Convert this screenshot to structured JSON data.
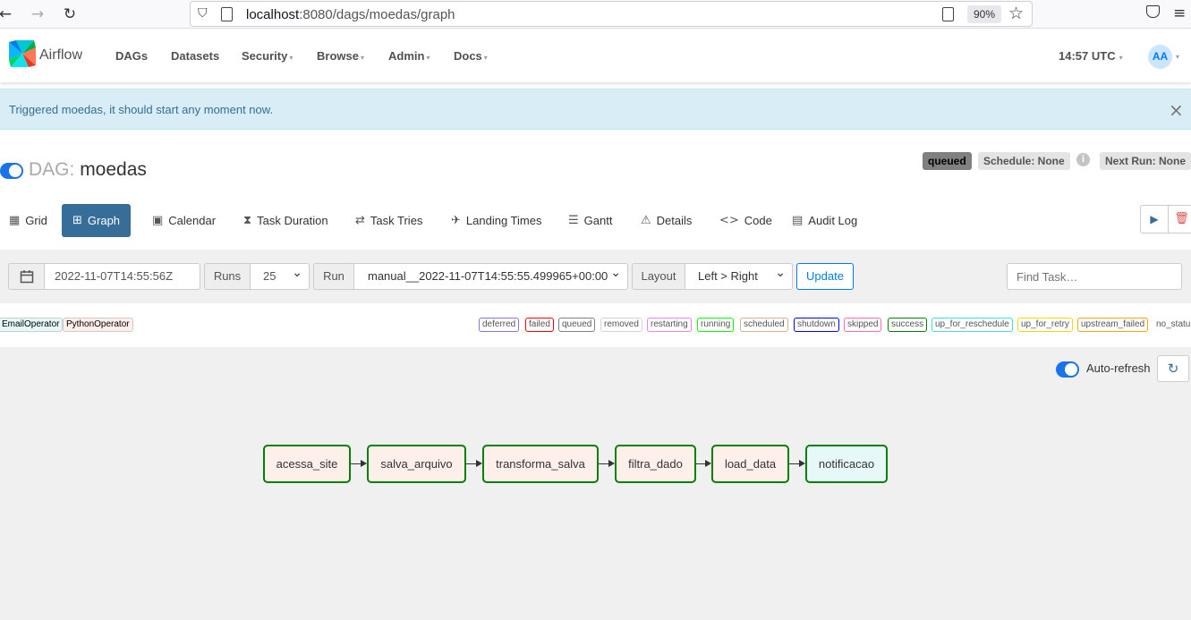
{
  "browser": {
    "url_host": "localhost",
    "url_rest": ":8080/dags/moedas/graph",
    "zoom": "90%"
  },
  "navbar": {
    "brand": "Airflow",
    "items": [
      "DAGs",
      "Datasets",
      "Security",
      "Browse",
      "Admin",
      "Docs"
    ],
    "clock": "14:57 UTC",
    "avatar": "AA"
  },
  "alert": {
    "message": "Triggered moedas, it should start any moment now.",
    "close": "×"
  },
  "dag": {
    "prefix": "DAG:",
    "name": "moedas",
    "state": "queued",
    "schedule": "Schedule: None",
    "next_run": "Next Run: None"
  },
  "tabs": [
    "Grid",
    "Graph",
    "Calendar",
    "Task Duration",
    "Task Tries",
    "Landing Times",
    "Gantt",
    "Details",
    "Code",
    "Audit Log"
  ],
  "filters": {
    "date": "2022-11-07T14:55:56Z",
    "runs_label": "Runs",
    "runs_value": "25",
    "run_label": "Run",
    "run_value": "manual__2022-11-07T14:55:55.499965+00:00",
    "layout_label": "Layout",
    "layout_value": "Left > Right",
    "update": "Update",
    "find_placeholder": "Find Task…"
  },
  "operators": [
    "EmailOperator",
    "PythonOperator"
  ],
  "states": [
    "deferred",
    "failed",
    "queued",
    "removed",
    "restarting",
    "running",
    "scheduled",
    "shutdown",
    "skipped",
    "success",
    "up_for_reschedule",
    "up_for_retry",
    "upstream_failed",
    "no_status"
  ],
  "graph": {
    "auto_refresh": "Auto-refresh",
    "nodes": [
      "acessa_site",
      "salva_arquivo",
      "transforma_salva",
      "filtra_dado",
      "load_data",
      "notificacao"
    ]
  },
  "colors": {
    "accent": "#017cee",
    "active_tab": "#366d99",
    "success_border": "#008000",
    "python_operator_bg": "#ffefeb",
    "email_operator_bg": "#e6f8f9"
  }
}
